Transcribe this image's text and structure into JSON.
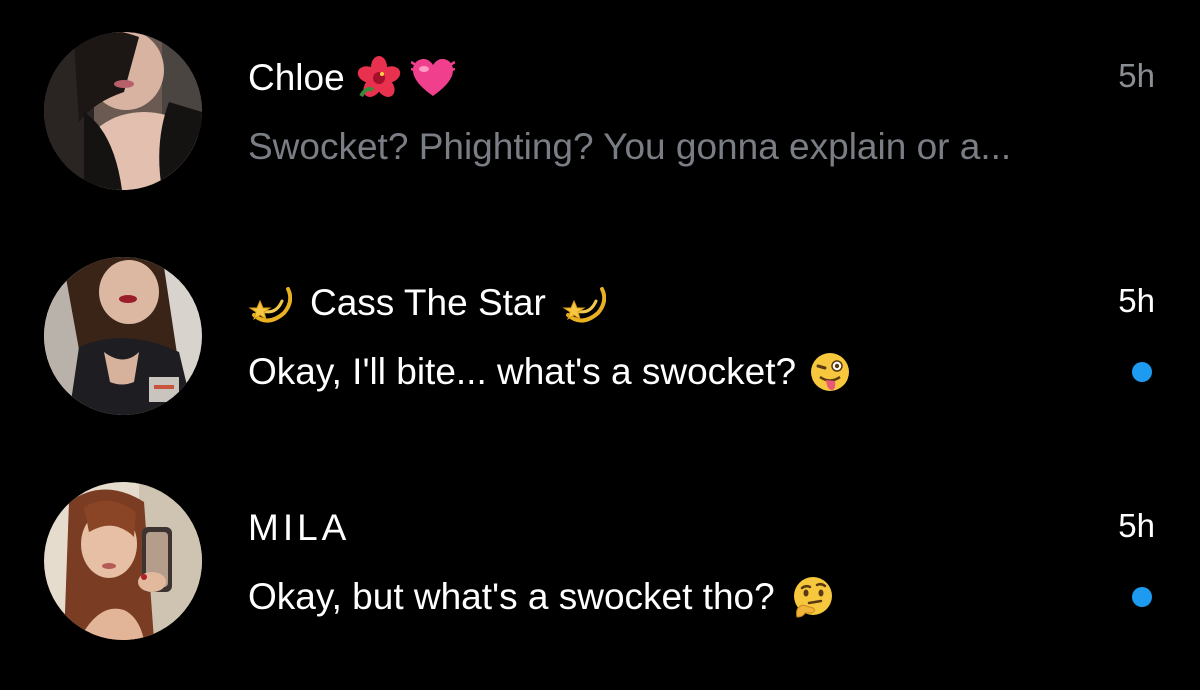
{
  "accent_color": "#1d9bf0",
  "conversations": [
    {
      "name": "Chloe",
      "name_emojis": [
        "hibiscus-icon",
        "beating-heart-icon"
      ],
      "time": "5h",
      "preview": "Swocket? Phighting? You gonna explain or a...",
      "unread": false
    },
    {
      "name": "Cass The Star",
      "name_emojis": [
        "dizzy-star-icon",
        "dizzy-star-icon"
      ],
      "time": "5h",
      "preview": "Okay, I'll bite... what's a swocket?",
      "preview_emoji": "winking-tongue-face-icon",
      "unread": true
    },
    {
      "name": "MILA",
      "time": "5h",
      "preview": "Okay, but what's a swocket tho?",
      "preview_emoji": "thinking-face-icon",
      "unread": true
    }
  ]
}
